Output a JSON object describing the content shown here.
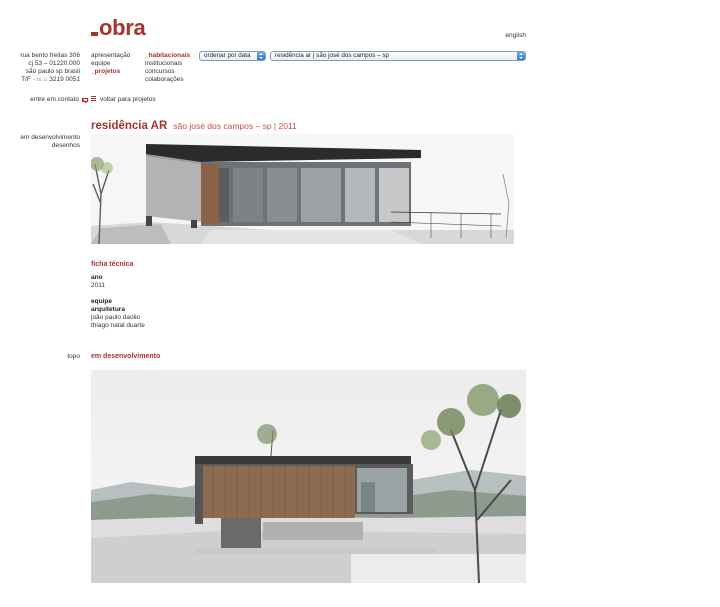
{
  "brand": {
    "logo_text": "obra",
    "accent": "#a9322d"
  },
  "language_link": "english",
  "address": {
    "line1": "rua bento freitas 306",
    "line2": "cj 53 – 01220.000",
    "line3": "são paulo sp brasil",
    "phone_prefix": "T/F",
    "phone_code": "+ 55 11",
    "phone_number": "3219 0051"
  },
  "contact_label": "entre em contato",
  "nav_primary": [
    "apresentação",
    "equipe",
    "_projetos"
  ],
  "nav_secondary": [
    "_habitacionais",
    "institucionais",
    "concursos",
    "colaborações"
  ],
  "order_select": {
    "value": "ordenar por data"
  },
  "project_select": {
    "value": "residência ar | são josé dos campos – sp"
  },
  "back_link": "voltar para projetos",
  "project": {
    "name": "residência AR",
    "location": "são josé dos campos – sp | 2011"
  },
  "side_links": [
    "em desenvolvimento",
    "desenhos"
  ],
  "ficha": {
    "title": "ficha técnica",
    "year_label": "ano",
    "year_value": "2011",
    "team_label": "equipe",
    "arch_label": "arquitetura",
    "architects": [
      "joão paulo daolio",
      "thiago natal duarte"
    ]
  },
  "top_link": "topo",
  "section_dev": "em desenvolvimento"
}
